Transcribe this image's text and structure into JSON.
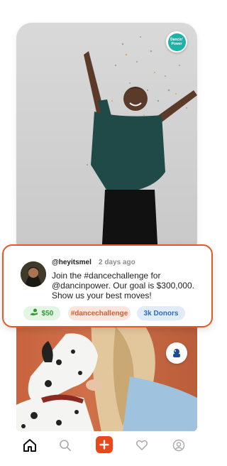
{
  "top_post": {
    "image": "woman-dancing-confetti",
    "org_badge": {
      "line1": "Dancin'",
      "line2": "Power"
    }
  },
  "info_card": {
    "username": "@heyitsmel",
    "time": "2 days ago",
    "text": "Join the #dancechallenge for @dancinpower. Our goal is $300,000. Show us your best moves!",
    "tags": {
      "donation": "$50",
      "hashtag": "#dancechallenge",
      "donors": "3k Donors"
    },
    "donation_icon": "hand-money-icon"
  },
  "bottom_post": {
    "image": "woman-with-dalmatian",
    "org_badge_icon": "dog-charity-logo"
  },
  "nav": {
    "items": [
      "home-icon",
      "search-icon",
      "add-icon",
      "heart-icon",
      "profile-icon"
    ],
    "active": "home-icon"
  },
  "colors": {
    "accent": "#e2592a",
    "add_button": "#e8481c",
    "money_pill": "#e3f5e3",
    "donors_pill": "#e1ecf9",
    "badge_teal": "#1fb3a8"
  }
}
